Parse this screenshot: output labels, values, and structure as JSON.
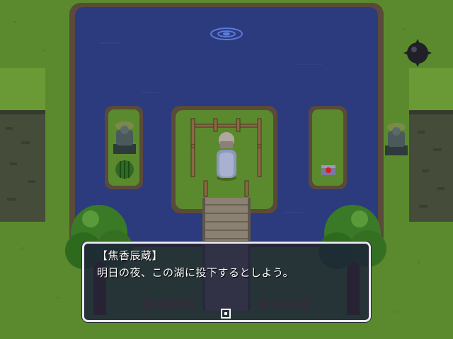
{
  "dialog": {
    "speaker": "【焦香辰蔵】",
    "line": "明日の夜、この湖に投下するとしよう。"
  },
  "scene": {
    "water_color": "#2c3a7e",
    "grass_color": "#5b8a2e",
    "cliff_color": "#454c3a",
    "bridge_color": "#8a8172"
  },
  "icons": {
    "advance": "advance-text-icon",
    "ripple": "water-ripple-icon",
    "spike": "spike-ball-icon",
    "statue": "guardian-statue-icon",
    "treasure": "treasure-box-icon"
  }
}
